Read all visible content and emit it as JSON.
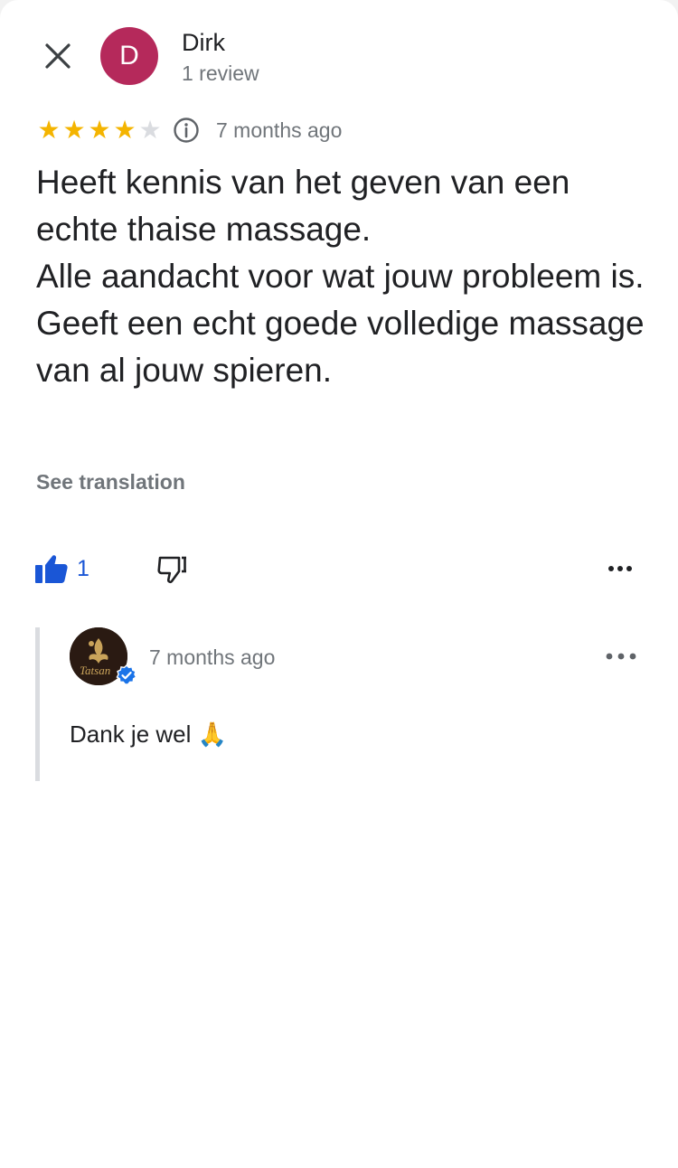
{
  "author": {
    "initial": "D",
    "name": "Dirk",
    "meta": "1 review",
    "avatar_color": "#b5295b"
  },
  "review": {
    "rating": 4,
    "max_rating": 5,
    "time": "7 months ago",
    "lines": [
      "Heeft kennis van het geven van een echte thaise massage.",
      "Alle aandacht voor wat jouw probleem is.",
      "Geeft een echt goede volledige massage van al jouw spieren."
    ],
    "see_translation": "See translation"
  },
  "actions": {
    "like_count": "1"
  },
  "owner_reply": {
    "time": "7 months ago",
    "text": "Dank je wel 🙏",
    "logo_text": "Tatsan"
  },
  "icons": {
    "close": "close-icon",
    "info": "info-icon",
    "like": "thumbs-up-icon",
    "dislike": "thumbs-down-icon",
    "more": "more-horizontal-icon",
    "verified": "verified-check-icon"
  },
  "colors": {
    "star": "#f4b400",
    "star_empty": "#dadce0",
    "accent_blue": "#1a56d6",
    "secondary_text": "#70757a"
  }
}
